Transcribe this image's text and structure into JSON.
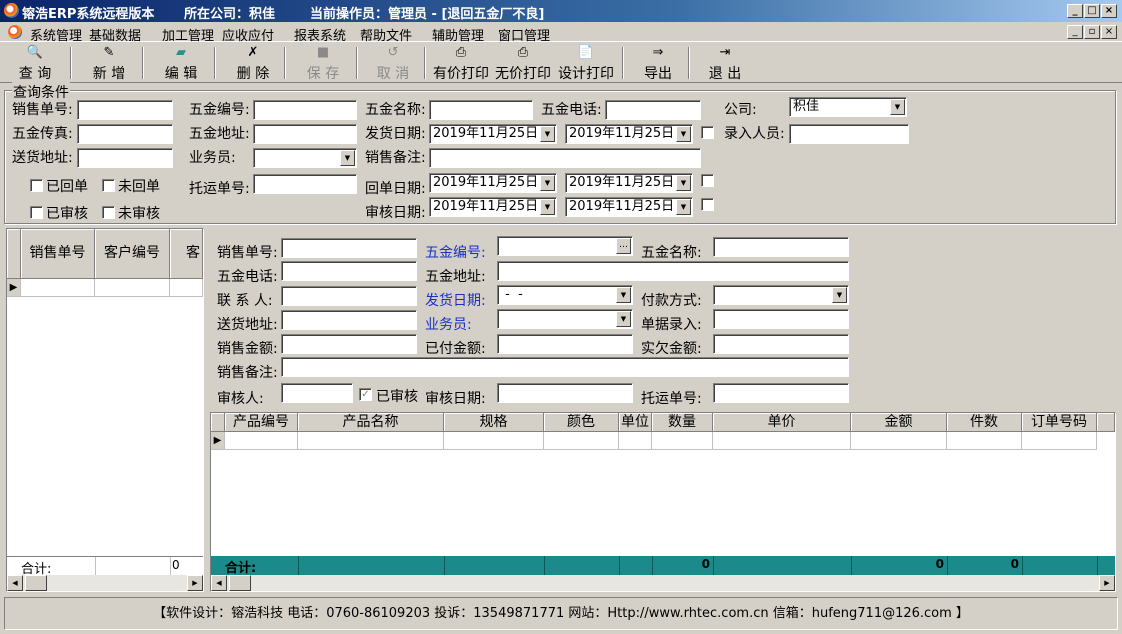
{
  "titlebar": {
    "app": "镕浩ERP系统远程版本",
    "company": "所在公司：积佳",
    "operator": "当前操作员：管理员 - [退回五金厂不良]",
    "buttons": [
      "_",
      "□",
      "×"
    ],
    "mdi_buttons": [
      "_",
      "▫",
      "×"
    ]
  },
  "menu": [
    "系统管理",
    "基础数据",
    "加工管理",
    "应收应付",
    "报表系统",
    "帮助文件",
    "辅助管理",
    "窗口管理"
  ],
  "toolbar": {
    "query": "查 询",
    "new": "新 增",
    "edit": "编 辑",
    "delete": "删 除",
    "save": "保 存",
    "cancel": "取 消",
    "print_price": "有价打印",
    "print_noprice": "无价打印",
    "print_design": "设计打印",
    "export": "导出",
    "exit": "退 出"
  },
  "query": {
    "group_title": "查询条件",
    "sale_no": "销售单号:",
    "hw_no": "五金编号:",
    "hw_name": "五金名称:",
    "hw_phone": "五金电话:",
    "company_label": "公司:",
    "company_value": "积佳",
    "hw_fax": "五金传真:",
    "hw_addr": "五金地址:",
    "ship_date": "发货日期:",
    "ship_from": "2019年11月25日",
    "ship_to": "2019年11月25日",
    "entry_user": "录入人员:",
    "deliver_addr": "送货地址:",
    "salesman": "业务员:",
    "sale_remark": "销售备注:",
    "returned": "已回单",
    "not_returned": "未回单",
    "freight_no": "托运单号:",
    "return_date": "回单日期:",
    "return_from": "2019年11月25日",
    "return_to": "2019年11月25日",
    "audited": "已审核",
    "not_audited": "未审核",
    "audit_date": "审核日期:",
    "audit_from": "2019年11月25日",
    "audit_to": "2019年11月25日"
  },
  "left_grid": {
    "columns": [
      "销售单号",
      "客户编号",
      "客"
    ],
    "total_label": "合计:",
    "total_value": "0"
  },
  "detail": {
    "sale_no": "销售单号:",
    "hw_no": "五金编号:",
    "hw_name": "五金名称:",
    "hw_phone": "五金电话:",
    "hw_addr": "五金地址:",
    "contact": "联 系 人:",
    "ship_date": "发货日期:",
    "ship_date_value": " -  -",
    "pay_method": "付款方式:",
    "deliver_addr": "送货地址:",
    "salesman": "业务员:",
    "doc_entry": "单据录入:",
    "sale_amount": "销售金额:",
    "paid_amount": "已付金额:",
    "owed_amount": "实欠金额:",
    "sale_remark": "销售备注:",
    "auditor": "审核人:",
    "audited": "已审核",
    "audit_date": "审核日期:",
    "freight_no": "托运单号:"
  },
  "items_grid": {
    "columns": [
      "产品编号",
      "产品名称",
      "规格",
      "颜色",
      "单位",
      "数量",
      "单价",
      "金额",
      "件数",
      "订单号码"
    ],
    "total_label": "合计:",
    "total_qty": "0",
    "total_amount": "0",
    "total_pieces": "0"
  },
  "status": "【软件设计：镕浩科技 电话：0760-86109203  投诉：13549871771 网站：Http://www.rhtec.com.cn 信箱：hufeng711@126.com 】"
}
